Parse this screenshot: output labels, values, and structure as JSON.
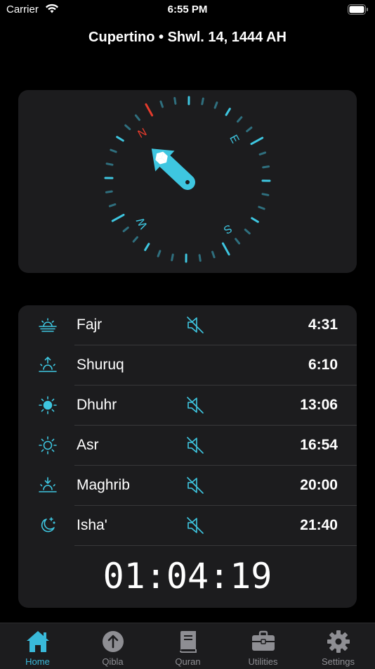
{
  "status_bar": {
    "carrier": "Carrier",
    "time": "6:55 PM"
  },
  "header": {
    "title": "Cupertino • Shwl. 14, 1444 AH"
  },
  "compass": {
    "labels": {
      "n": "N",
      "e": "E",
      "s": "S",
      "w": "W"
    },
    "accent_color": "#3ec6e0",
    "north_color": "#e53b2c"
  },
  "prayers": [
    {
      "name": "Fajr",
      "time": "4:31",
      "icon": "fajr-sunrise-lines-icon",
      "muted": true
    },
    {
      "name": "Shuruq",
      "time": "6:10",
      "icon": "sunrise-arrow-up-icon",
      "muted": false
    },
    {
      "name": "Dhuhr",
      "time": "13:06",
      "icon": "sun-filled-icon",
      "muted": true
    },
    {
      "name": "Asr",
      "time": "16:54",
      "icon": "sun-outline-icon",
      "muted": true
    },
    {
      "name": "Maghrib",
      "time": "20:00",
      "icon": "sunset-arrow-down-icon",
      "muted": true
    },
    {
      "name": "Isha'",
      "time": "21:40",
      "icon": "moon-stars-icon",
      "muted": true
    }
  ],
  "countdown": "01:04:19",
  "tabs": [
    {
      "label": "Home",
      "icon": "house-icon",
      "active": true
    },
    {
      "label": "Qibla",
      "icon": "arrow-up-circle-icon",
      "active": false
    },
    {
      "label": "Quran",
      "icon": "book-icon",
      "active": false
    },
    {
      "label": "Utilities",
      "icon": "briefcase-icon",
      "active": false
    },
    {
      "label": "Settings",
      "icon": "gear-icon",
      "active": false
    }
  ],
  "colors": {
    "accent": "#39b9d9",
    "card": "#1c1c1e",
    "inactive": "#8e8e93"
  }
}
